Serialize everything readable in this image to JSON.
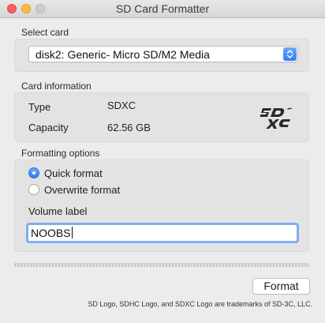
{
  "window": {
    "title": "SD Card Formatter"
  },
  "select_card": {
    "label": "Select card",
    "selected": "disk2: Generic- Micro SD/M2 Media",
    "arrows_icon": "updown-chevron-icon"
  },
  "card_info": {
    "label": "Card information",
    "type_label": "Type",
    "type_value": "SDXC",
    "capacity_label": "Capacity",
    "capacity_value": "62.56 GB",
    "logo_icon": "sdxc-logo-icon",
    "logo_text": "SDXC"
  },
  "formatting": {
    "label": "Formatting options",
    "quick_format": "Quick format",
    "overwrite_format": "Overwrite format",
    "selected_option": "Quick format",
    "volume_label_heading": "Volume label",
    "volume_label_value": "NOOBS"
  },
  "actions": {
    "format_label": "Format"
  },
  "footer": {
    "trademark": "SD Logo, SDHC Logo, and SDXC Logo are trademarks of SD-3C, LLC."
  },
  "colors": {
    "accent": "#2f7ef6",
    "focus_ring": "#7eaef2",
    "close": "#fc605c",
    "minimize": "#fdbc40"
  }
}
